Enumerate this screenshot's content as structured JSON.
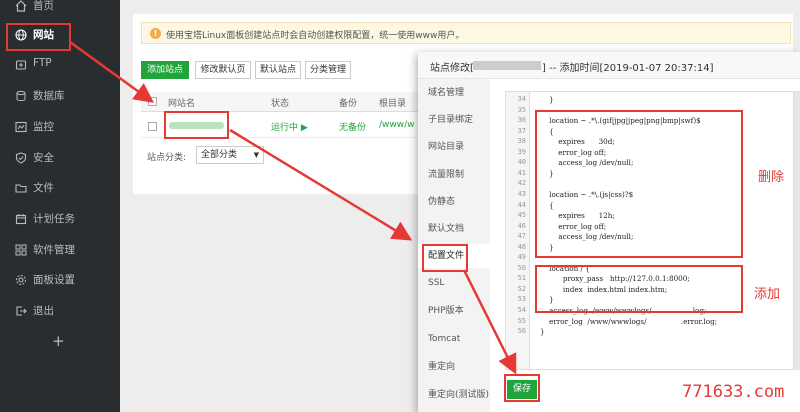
{
  "sidebar": {
    "items": [
      {
        "label": "首页",
        "icon": "home-icon"
      },
      {
        "label": "网站",
        "icon": "globe-icon"
      },
      {
        "label": "FTP",
        "icon": "ftp-icon"
      },
      {
        "label": "数据库",
        "icon": "database-icon"
      },
      {
        "label": "监控",
        "icon": "monitor-icon"
      },
      {
        "label": "安全",
        "icon": "shield-icon"
      },
      {
        "label": "文件",
        "icon": "folder-icon"
      },
      {
        "label": "计划任务",
        "icon": "calendar-icon"
      },
      {
        "label": "软件管理",
        "icon": "apps-icon"
      },
      {
        "label": "面板设置",
        "icon": "settings-icon"
      },
      {
        "label": "退出",
        "icon": "logout-icon"
      }
    ],
    "add_icon": "plus-icon"
  },
  "notice": {
    "text": "使用宝塔Linux面板创建站点时会自动创建权限配置，统一使用www用户。"
  },
  "toolbar": {
    "add_site": "添加站点",
    "edit_default_page": "修改默认页",
    "default_site": "默认站点",
    "category_manage": "分类管理"
  },
  "table": {
    "headers": [
      "网站名",
      "状态",
      "备份",
      "根目录"
    ],
    "row": {
      "status": "运行中",
      "backup": "无备份",
      "root": "/www/w"
    }
  },
  "filter": {
    "label": "站点分类:",
    "selected": "全部分类"
  },
  "modal": {
    "title_prefix": "站点修改[",
    "title_suffix": "] -- 添加时间[2019-01-07 20:37:14]",
    "nav": [
      "域名管理",
      "子目录绑定",
      "网站目录",
      "流量限制",
      "伪静态",
      "默认文档",
      "配置文件",
      "SSL",
      "PHP版本",
      "Tomcat",
      "重定向",
      "重定向(测试版)"
    ],
    "active_nav": "配置文件",
    "save": "保存"
  },
  "code_lines": [
    {
      "n": "34",
      "t": "    }"
    },
    {
      "n": "35",
      "t": ""
    },
    {
      "n": "36",
      "t": "    location ~ .*\\.(gif|jpg|jpeg|png|bmp|swf)$"
    },
    {
      "n": "37",
      "t": "    {"
    },
    {
      "n": "38",
      "t": "        expires      30d;"
    },
    {
      "n": "39",
      "t": "        error_log off;"
    },
    {
      "n": "40",
      "t": "        access_log /dev/null;"
    },
    {
      "n": "41",
      "t": "    }"
    },
    {
      "n": "42",
      "t": ""
    },
    {
      "n": "43",
      "t": "    location ~ .*\\.(js|css)?$"
    },
    {
      "n": "44",
      "t": "    {"
    },
    {
      "n": "45",
      "t": "        expires      12h;"
    },
    {
      "n": "46",
      "t": "        error_log off;"
    },
    {
      "n": "47",
      "t": "        access_log /dev/null;"
    },
    {
      "n": "48",
      "t": "    }"
    },
    {
      "n": "49",
      "t": ""
    },
    {
      "n": "50",
      "t": "    location / {"
    },
    {
      "n": "51",
      "t": "          proxy_pass   http://127.0.0.1:8000;"
    },
    {
      "n": "52",
      "t": "          index  index.html index.htm;"
    },
    {
      "n": "53",
      "t": "    }"
    },
    {
      "n": "54",
      "t": "    access_log  /www/wwwlogs/                 .log;"
    },
    {
      "n": "55",
      "t": "    error_log  /www/wwwlogs/               .error.log;"
    },
    {
      "n": "56",
      "t": "}"
    }
  ],
  "annotations": {
    "delete": "删除",
    "add": "添加"
  },
  "watermark": "771633.com"
}
